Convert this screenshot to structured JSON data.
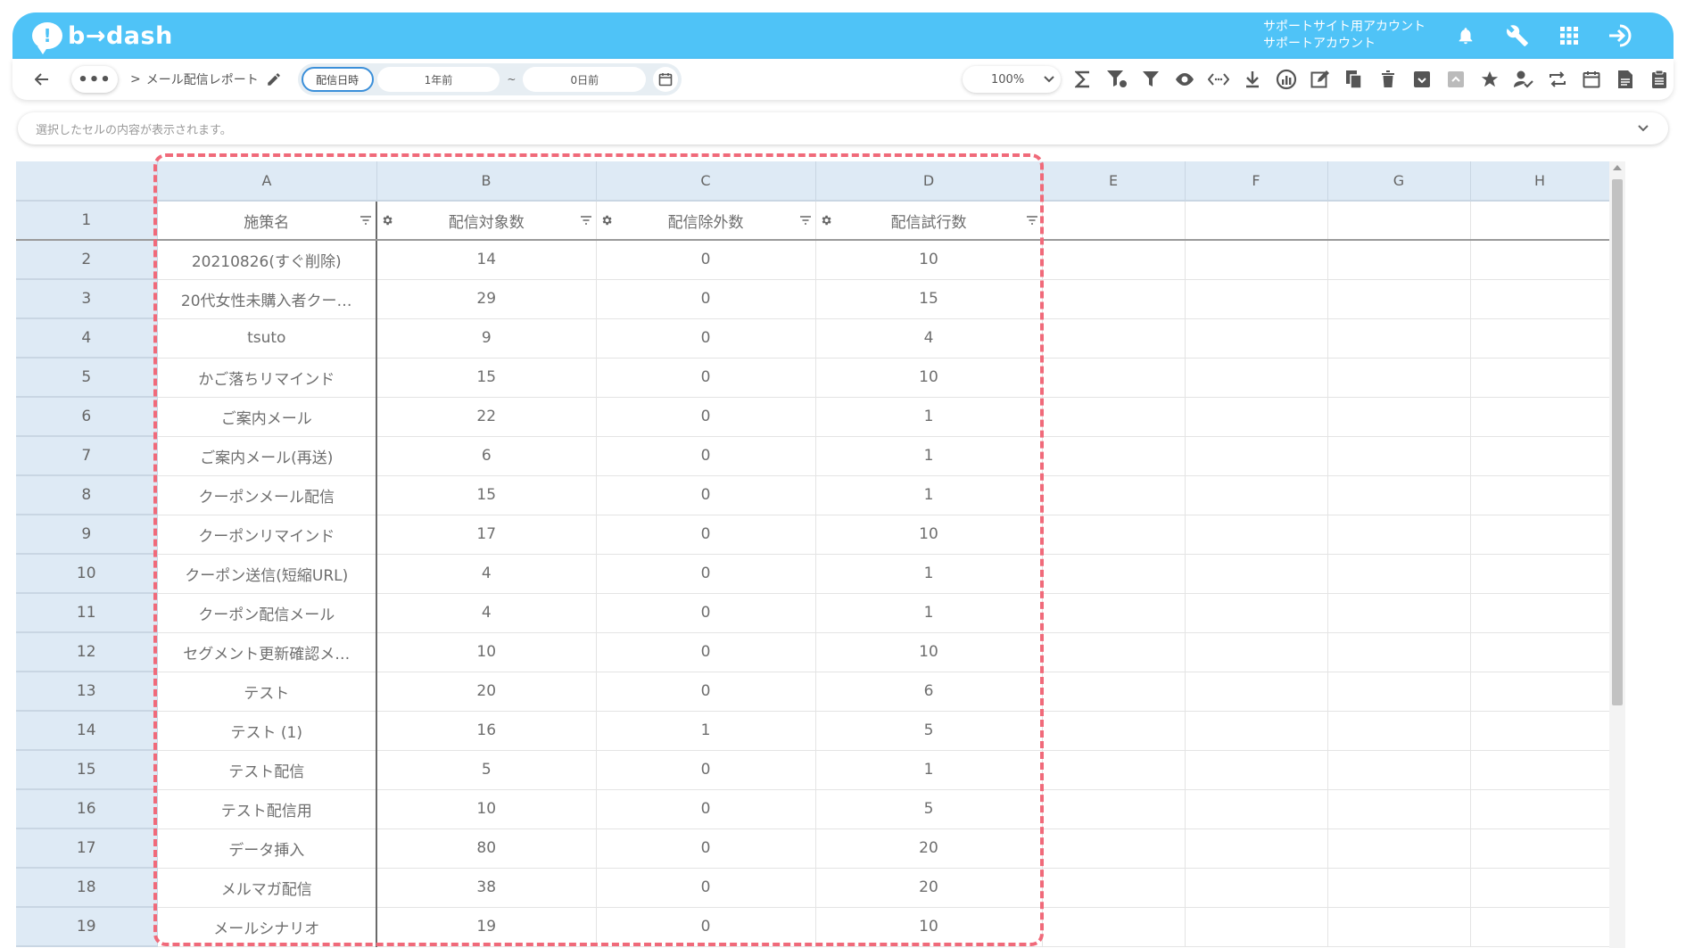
{
  "header": {
    "logo_text": "b→dash",
    "account_line1": "サポートサイト用アカウント",
    "account_line2": "サポートアカウント",
    "icons": [
      "bell-icon",
      "wrench-icon",
      "apps-grid-icon",
      "logout-icon"
    ]
  },
  "toolbar": {
    "more_label": "•••",
    "breadcrumb_sep": ">",
    "report_title": "メール配信レポート",
    "date_label": "配信日時",
    "date_from": "1年前",
    "date_sep": "~",
    "date_to": "0日前",
    "zoom": "100%"
  },
  "formula_bar": {
    "placeholder": "選択したセルの内容が表示されます。"
  },
  "grid": {
    "columns": [
      "A",
      "B",
      "C",
      "D",
      "E",
      "F",
      "G",
      "H"
    ],
    "field_headers": [
      "施策名",
      "配信対象数",
      "配信除外数",
      "配信試行数"
    ],
    "header_row_number": "1",
    "rows": [
      {
        "n": "2",
        "a": "20210826(すぐ削除)",
        "b": "14",
        "c": "0",
        "d": "10"
      },
      {
        "n": "3",
        "a": "20代女性未購入者クー…",
        "b": "29",
        "c": "0",
        "d": "15"
      },
      {
        "n": "4",
        "a": "tsuto",
        "b": "9",
        "c": "0",
        "d": "4"
      },
      {
        "n": "5",
        "a": "かご落ちリマインド",
        "b": "15",
        "c": "0",
        "d": "10"
      },
      {
        "n": "6",
        "a": "ご案内メール",
        "b": "22",
        "c": "0",
        "d": "1"
      },
      {
        "n": "7",
        "a": "ご案内メール(再送)",
        "b": "6",
        "c": "0",
        "d": "1"
      },
      {
        "n": "8",
        "a": "クーポンメール配信",
        "b": "15",
        "c": "0",
        "d": "1"
      },
      {
        "n": "9",
        "a": "クーポンリマインド",
        "b": "17",
        "c": "0",
        "d": "10"
      },
      {
        "n": "10",
        "a": "クーポン送信(短縮URL)",
        "b": "4",
        "c": "0",
        "d": "1"
      },
      {
        "n": "11",
        "a": "クーポン配信メール",
        "b": "4",
        "c": "0",
        "d": "1"
      },
      {
        "n": "12",
        "a": "セグメント更新確認メ…",
        "b": "10",
        "c": "0",
        "d": "10"
      },
      {
        "n": "13",
        "a": "テスト",
        "b": "20",
        "c": "0",
        "d": "6"
      },
      {
        "n": "14",
        "a": "テスト (1)",
        "b": "16",
        "c": "1",
        "d": "5"
      },
      {
        "n": "15",
        "a": "テスト配信",
        "b": "5",
        "c": "0",
        "d": "1"
      },
      {
        "n": "16",
        "a": "テスト配信用",
        "b": "10",
        "c": "0",
        "d": "5"
      },
      {
        "n": "17",
        "a": "データ挿入",
        "b": "80",
        "c": "0",
        "d": "20"
      },
      {
        "n": "18",
        "a": "メルマガ配信",
        "b": "38",
        "c": "0",
        "d": "20"
      },
      {
        "n": "19",
        "a": "メールシナリオ",
        "b": "19",
        "c": "0",
        "d": "10"
      }
    ]
  },
  "colors": {
    "header_bg": "#4fc3f7",
    "grid_header_bg": "#deeaf5",
    "highlight": "#f06a7a",
    "date_label_border": "#3b8fd9"
  }
}
